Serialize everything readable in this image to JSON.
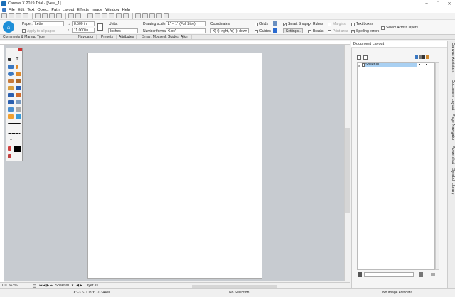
{
  "window": {
    "title": "Canvas X 2019 Trial - [New_1]"
  },
  "window_controls": {
    "minimize": "–",
    "maximize": "□",
    "close": "✕"
  },
  "menu": [
    "File",
    "Edit",
    "Text",
    "Object",
    "Path",
    "Layout",
    "Effects",
    "Image",
    "Window",
    "Help"
  ],
  "inspector": {
    "paper_label": "Paper:",
    "paper_value": "Letter",
    "width_value": "8.500 in",
    "height_value": "11.000 in",
    "apply_all": "Apply to all pages",
    "units_label": "Units:",
    "units_value": "Inches",
    "drawing_scale_label": "Drawing scale:",
    "drawing_scale_value": "1\" = 1\" (Full Size)",
    "number_format_label": "Number format:",
    "number_format_value": "X.xx\"",
    "coordinates_label": "Coordinates:",
    "coordinates_value": "X(+): right, Y(+): down",
    "grids": "Grids",
    "guides": "Guides",
    "smart_snaps": "Smart Snaps",
    "settings": "Settings...",
    "rulers": "Rulers",
    "breaks": "Breaks",
    "margins": "Margins",
    "print_area": "Print area",
    "text_boxes": "Text boxes",
    "spelling_errors": "Spelling errors",
    "select_across_layers": "Select Across layers"
  },
  "tabs": [
    "Comments & Markup",
    "Type",
    "Navigator",
    "Presets",
    "Attributes",
    "Smart Mouse & Guides",
    "Align"
  ],
  "panel": {
    "title": "Document Layout",
    "sheet": "Sheet #1"
  },
  "side_tabs": [
    "Canvas Assistant",
    "Document Layout",
    "Page Navigator",
    "Powershot",
    "Symbol Library"
  ],
  "bottom": {
    "zoom": "101.563%",
    "sheet": "Sheet #1",
    "layer": "Layer #1"
  },
  "status": {
    "coords": "X: -3.671 in Y: -1.344 in",
    "selection": "No Selection",
    "image": "No image edit data"
  },
  "colors": {
    "accent": "#1e8fd8",
    "canvas_bg": "#c7cbd0",
    "selection": "#a9d0f2"
  }
}
